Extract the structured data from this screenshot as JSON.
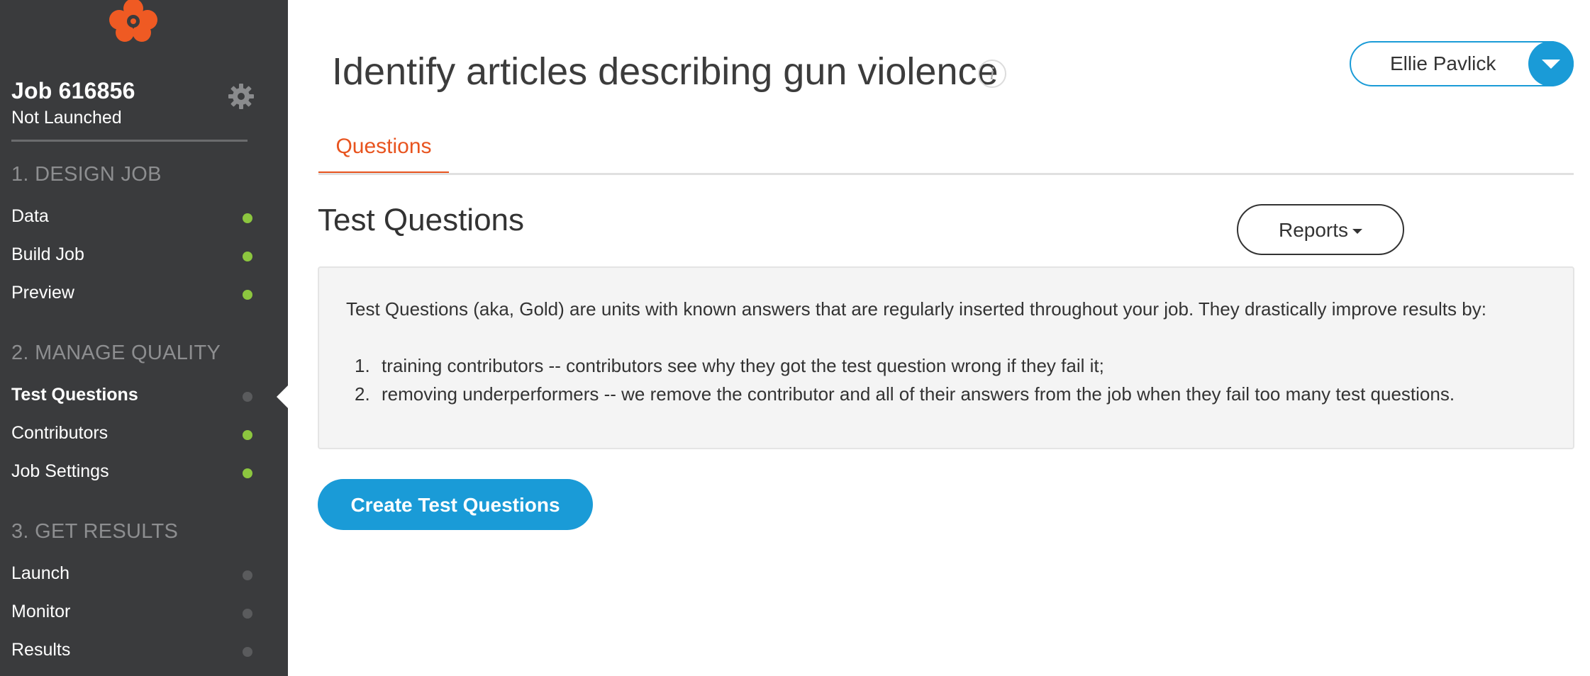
{
  "sidebar": {
    "job_title": "Job 616856",
    "job_status": "Not Launched",
    "sections": [
      {
        "label": "1. DESIGN JOB",
        "items": [
          {
            "label": "Data",
            "status": "done"
          },
          {
            "label": "Build Job",
            "status": "done"
          },
          {
            "label": "Preview",
            "status": "done"
          }
        ]
      },
      {
        "label": "2. MANAGE QUALITY",
        "items": [
          {
            "label": "Test Questions",
            "status": "pending",
            "active": true
          },
          {
            "label": "Contributors",
            "status": "done"
          },
          {
            "label": "Job Settings",
            "status": "done"
          }
        ]
      },
      {
        "label": "3. GET RESULTS",
        "items": [
          {
            "label": "Launch",
            "status": "pending"
          },
          {
            "label": "Monitor",
            "status": "pending"
          },
          {
            "label": "Results",
            "status": "pending"
          }
        ]
      }
    ]
  },
  "header": {
    "title": "Identify articles describing gun violence",
    "info_icon": "info-icon",
    "user_name": "Ellie Pavlick"
  },
  "tabs": [
    {
      "label": "Questions",
      "active": true
    }
  ],
  "main": {
    "section_title": "Test Questions",
    "reports_label": "Reports",
    "info_intro": "Test Questions (aka, Gold) are units with known answers that are regularly inserted throughout your job. They drastically improve results by:",
    "info_items": [
      "training contributors -- contributors see why they got the test question wrong if they fail it;",
      "removing underperformers -- we remove the contributor and all of their answers from the job when they fail too many test questions."
    ],
    "create_button_label": "Create Test Questions"
  },
  "colors": {
    "sidebar_bg": "#3a3b3d",
    "accent_orange": "#e8541f",
    "accent_blue": "#1a9bd7",
    "status_done": "#8cc63f",
    "status_pending": "#5a5b5d"
  }
}
